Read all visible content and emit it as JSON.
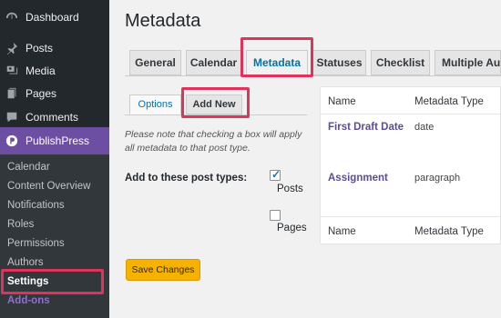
{
  "sidebar": {
    "items": [
      {
        "label": "Dashboard",
        "icon": "dashboard-icon"
      },
      {
        "label": "Posts",
        "icon": "pin-icon"
      },
      {
        "label": "Media",
        "icon": "media-icon"
      },
      {
        "label": "Pages",
        "icon": "pages-icon"
      },
      {
        "label": "Comments",
        "icon": "comments-icon"
      },
      {
        "label": "PublishPress",
        "icon": "publishpress-icon"
      }
    ],
    "submenu": [
      "Calendar",
      "Content Overview",
      "Notifications",
      "Roles",
      "Permissions",
      "Authors",
      "Settings",
      "Add-ons"
    ]
  },
  "main": {
    "title": "Metadata",
    "tabs": [
      "General",
      "Calendar",
      "Metadata",
      "Statuses",
      "Checklist",
      "Multiple Auth"
    ],
    "subtabs": [
      "Options",
      "Add New"
    ],
    "note": "Please note that checking a box will apply all metadata to that post type.",
    "form_label": "Add to these post types:",
    "checkboxes": [
      {
        "label": "Posts",
        "checked": true
      },
      {
        "label": "Pages",
        "checked": false
      }
    ],
    "save_label": "Save Changes"
  },
  "table": {
    "headers": [
      "Name",
      "Metadata Type"
    ],
    "rows": [
      {
        "name": "First Draft Date",
        "type": "date"
      },
      {
        "name": "Assignment",
        "type": "paragraph"
      }
    ],
    "footers": [
      "Name",
      "Metadata Type"
    ]
  },
  "colors": {
    "sidebar_bg": "#23282d",
    "publishpress_accent": "#6c4ea3",
    "highlight_red": "#e0335b",
    "button_orange": "#f7b200",
    "link_purple": "#5b4b9a"
  }
}
